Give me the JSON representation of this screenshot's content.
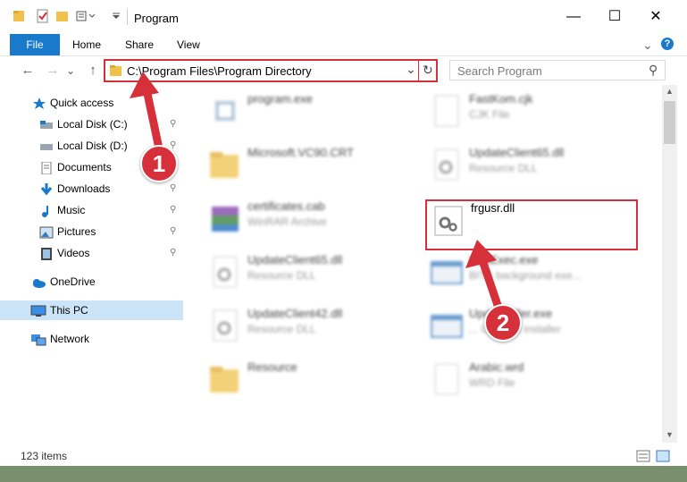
{
  "window": {
    "title": "Program",
    "minimize_glyph": "—",
    "maximize_glyph": "☐",
    "close_glyph": "✕"
  },
  "ribbon": {
    "tabs": [
      "File",
      "Home",
      "Share",
      "View"
    ],
    "help_glyph": "?",
    "expand_glyph": "⌄"
  },
  "navigation": {
    "back_glyph": "←",
    "forward_glyph": "→",
    "recent_glyph": "⌄",
    "up_glyph": "↑"
  },
  "address": {
    "path": "C:\\Program Files\\Program Directory",
    "dropdown_glyph": "⌄",
    "refresh_glyph": "↻"
  },
  "search": {
    "placeholder": "Search Program",
    "icon_glyph": "⚲"
  },
  "sidebar": {
    "quick_access": "Quick access",
    "items": [
      {
        "label": "Local Disk (C:)",
        "icon": "hard-drive-icon"
      },
      {
        "label": "Local Disk (D:)",
        "icon": "hard-drive-icon"
      },
      {
        "label": "Documents",
        "icon": "documents-icon"
      },
      {
        "label": "Downloads",
        "icon": "downloads-icon"
      },
      {
        "label": "Music",
        "icon": "music-icon"
      },
      {
        "label": "Pictures",
        "icon": "pictures-icon"
      },
      {
        "label": "Videos",
        "icon": "videos-icon"
      }
    ],
    "pin_glyph": "📌",
    "onedrive": "OneDrive",
    "this_pc": "This PC",
    "network": "Network"
  },
  "files": [
    {
      "name": "program.exe",
      "type": ""
    },
    {
      "name": "FastKom.cjk",
      "type": "CJK File"
    },
    {
      "name": "Microsoft.VC90.CRT",
      "type": ""
    },
    {
      "name": "UpdateClient65.dll",
      "type": "Resource DLL"
    },
    {
      "name": "certificates.cab",
      "type": "WinRAR Archive"
    },
    {
      "name": "frgusr.dll",
      "type": ""
    },
    {
      "name": "UpdateClient65.dll",
      "type": "Resource DLL"
    },
    {
      "name": "UpdExec.exe",
      "type": "BITS background exe..."
    },
    {
      "name": "UpdateClient42.dll",
      "type": "Resource DLL"
    },
    {
      "name": "UpdInstaller.exe",
      "type": "... Updates installer"
    },
    {
      "name": "Resource",
      "type": ""
    },
    {
      "name": "Arabic.wrd",
      "type": "WRD File"
    }
  ],
  "callouts": {
    "first": "1",
    "second": "2"
  },
  "status": {
    "count": "123 items"
  },
  "colors": {
    "accent": "#1979ca",
    "highlight": "#d6303a",
    "selected": "#cce4f7"
  }
}
